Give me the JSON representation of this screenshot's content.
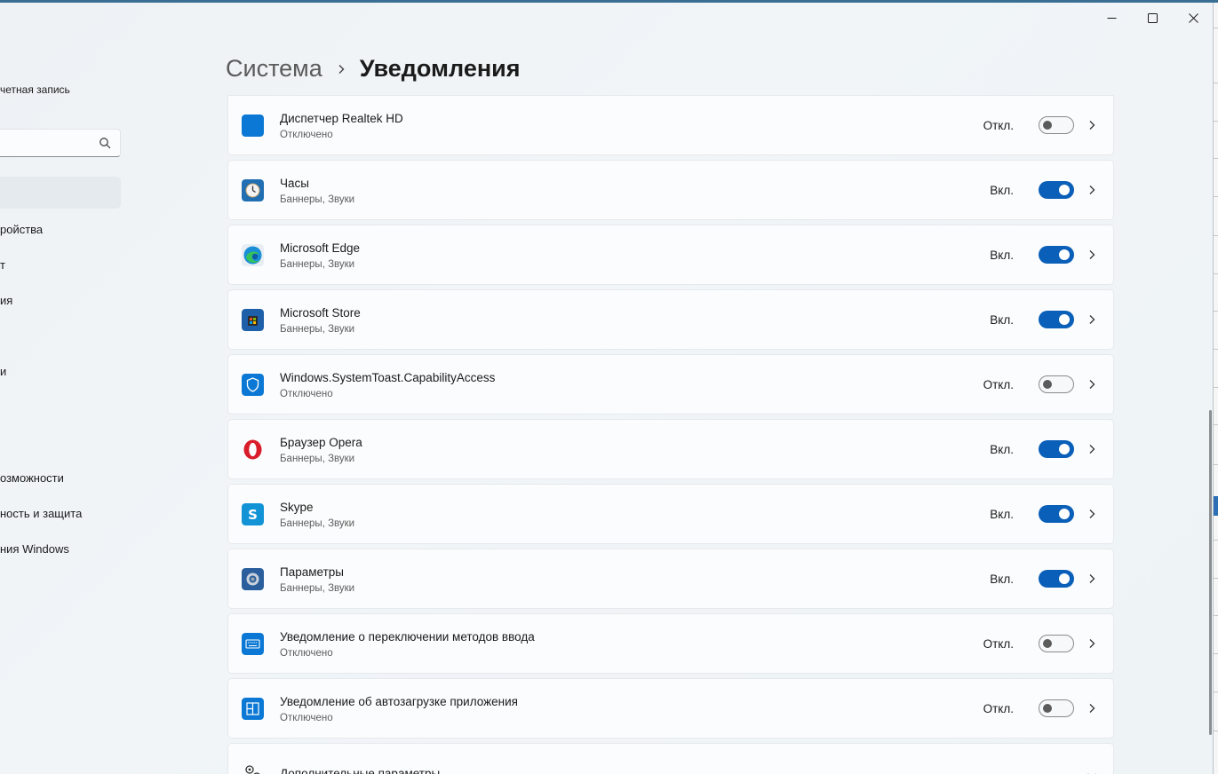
{
  "window": {
    "controls": [
      "minimize",
      "maximize",
      "close"
    ]
  },
  "sidebar": {
    "account_label": "четная запись",
    "search": {
      "placeholder": ""
    },
    "items": [
      {
        "label": "ройства"
      },
      {
        "label": "т"
      },
      {
        "label": "ия"
      },
      {
        "label": "и"
      },
      {
        "label": "озможности"
      },
      {
        "label": "ность и защита"
      },
      {
        "label": "ния Windows"
      }
    ]
  },
  "breadcrumb": {
    "parent": "Система",
    "current": "Уведомления"
  },
  "apps": [
    {
      "name": "Диспетчер Realtek HD",
      "subtitle": "Отключено",
      "state": "Откл.",
      "on": false,
      "icon": "realtek-icon",
      "color": "#0a78d4"
    },
    {
      "name": "Часы",
      "subtitle": "Баннеры, Звуки",
      "state": "Вкл.",
      "on": true,
      "icon": "clock-icon",
      "color": "#1f6fb2"
    },
    {
      "name": "Microsoft Edge",
      "subtitle": "Баннеры, Звуки",
      "state": "Вкл.",
      "on": true,
      "icon": "edge-icon",
      "color": "#1a8fd6"
    },
    {
      "name": "Microsoft Store",
      "subtitle": "Баннеры, Звуки",
      "state": "Вкл.",
      "on": true,
      "icon": "store-icon",
      "color": "#1d5fa8"
    },
    {
      "name": "Windows.SystemToast.CapabilityAccess",
      "subtitle": "Отключено",
      "state": "Откл.",
      "on": false,
      "icon": "shield-icon",
      "color": "#0a78d4"
    },
    {
      "name": "Браузер Opera",
      "subtitle": "Баннеры, Звуки",
      "state": "Вкл.",
      "on": true,
      "icon": "opera-icon",
      "color": "#d91c2a"
    },
    {
      "name": "Skype",
      "subtitle": "Баннеры, Звуки",
      "state": "Вкл.",
      "on": true,
      "icon": "skype-icon",
      "color": "#1193d6"
    },
    {
      "name": "Параметры",
      "subtitle": "Баннеры, Звуки",
      "state": "Вкл.",
      "on": true,
      "icon": "settings-gear-icon",
      "color": "#2a5e9c"
    },
    {
      "name": "Уведомление о переключении методов ввода",
      "subtitle": "Отключено",
      "state": "Откл.",
      "on": false,
      "icon": "keyboard-icon",
      "color": "#0a78d4"
    },
    {
      "name": "Уведомление об автозагрузке приложения",
      "subtitle": "Отключено",
      "state": "Откл.",
      "on": false,
      "icon": "startup-apps-icon",
      "color": "#0a78d4"
    }
  ],
  "more": {
    "label": "Дополнительные параметры"
  },
  "colors": {
    "accent": "#0a5fb8",
    "row_bg": "#fbfcfd",
    "page_bg": "#eef2f5"
  }
}
